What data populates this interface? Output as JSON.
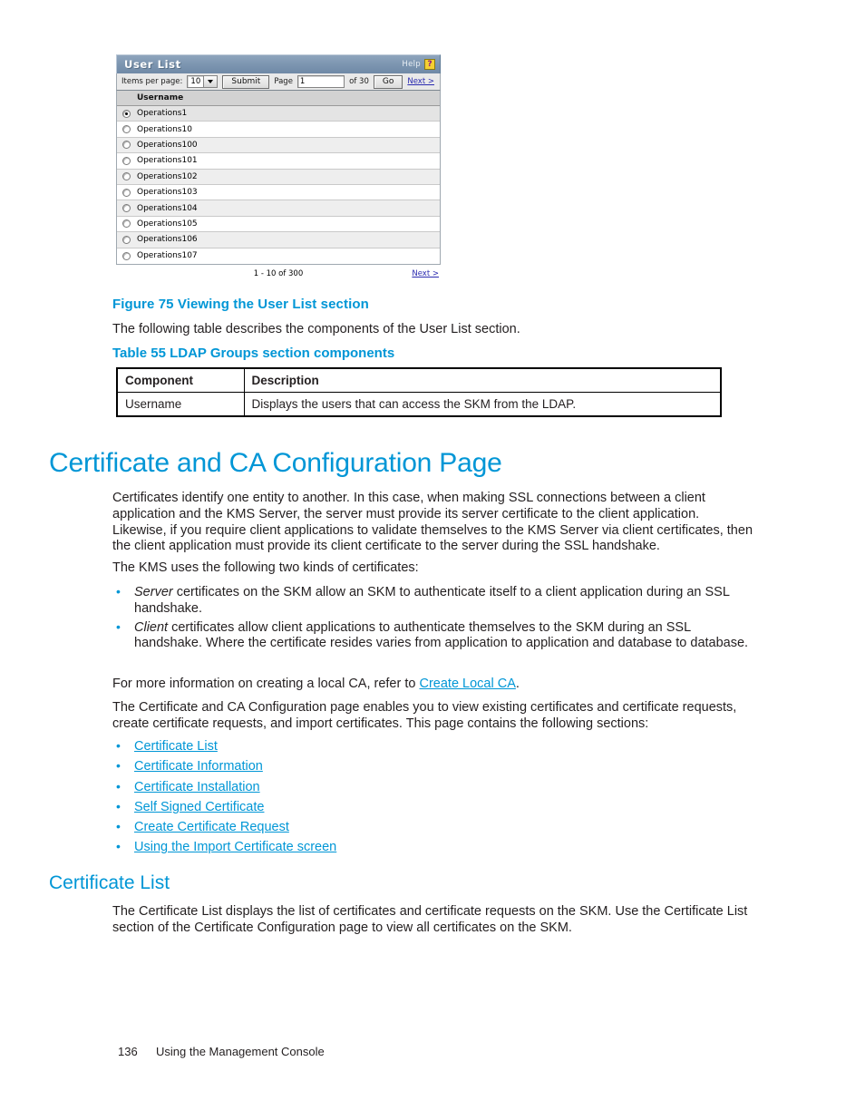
{
  "screenshot": {
    "title": "User List",
    "help_label": "Help",
    "help_icon": "question-mark-icon",
    "toolbar": {
      "items_per_page_label": "Items per page:",
      "items_per_page_value": "10",
      "submit_label": "Submit",
      "page_label": "Page",
      "page_value": "1",
      "of_label": "of 30",
      "go_label": "Go",
      "next_label": "Next >"
    },
    "column_header": "Username",
    "rows": [
      {
        "username": "Operations1",
        "selected": true
      },
      {
        "username": "Operations10",
        "selected": false
      },
      {
        "username": "Operations100",
        "selected": false
      },
      {
        "username": "Operations101",
        "selected": false
      },
      {
        "username": "Operations102",
        "selected": false
      },
      {
        "username": "Operations103",
        "selected": false
      },
      {
        "username": "Operations104",
        "selected": false
      },
      {
        "username": "Operations105",
        "selected": false
      },
      {
        "username": "Operations106",
        "selected": false
      },
      {
        "username": "Operations107",
        "selected": false
      }
    ],
    "footer": {
      "range": "1 - 10 of 300",
      "next_label": "Next >"
    }
  },
  "document": {
    "figure_caption": "Figure 75 Viewing the User List section",
    "intro_paragraph": "The following table describes the components of the User List section.",
    "table_caption": "Table 55 LDAP Groups section components",
    "table": {
      "headers": [
        "Component",
        "Description"
      ],
      "rows": [
        [
          "Username",
          "Displays the users that can access the SKM from the LDAP."
        ]
      ]
    },
    "page_title": "Certificate and CA Configuration Page",
    "p1": "Certificates identify one entity to another.  In this case, when making SSL connections between a client application and the KMS Server, the server must provide its server certificate to the client application.  Likewise, if you require client applications to validate themselves to the KMS Server via client certificates, then the client application must provide its client certificate to the server during the SSL handshake.",
    "p2": "The KMS uses the following two kinds of certificates:",
    "cert_kinds": [
      {
        "emphasis": "Server",
        "text": " certificates on the SKM allow an SKM to authenticate itself to a client application during an SSL handshake."
      },
      {
        "emphasis": "Client",
        "text": " certificates allow client applications to authenticate themselves to the SKM during an SSL handshake.  Where the certificate resides varies from application to application and database to database."
      }
    ],
    "p3_before_link": "For more information on creating a local CA, refer to ",
    "p3_link": "Create Local CA",
    "p3_after_link": ".",
    "p4": "The Certificate and CA Configuration page enables you to view existing certificates and certificate requests, create certificate requests, and import certificates.  This page contains the following sections:",
    "sections": [
      "Certificate List",
      "Certificate Information",
      "Certificate Installation",
      "Self Signed Certificate",
      "Create Certificate Request",
      "Using the Import Certificate screen"
    ],
    "section_title": "Certificate List",
    "p5": "The Certificate List displays the list of certificates and certificate requests on the SKM. Use the Certificate List section of the Certificate Configuration page to view all certificates on the SKM.",
    "footer": {
      "page_number": "136",
      "chapter": "Using the Management Console"
    }
  },
  "colors": {
    "heading_blue": "#0096D6",
    "link_blue": "#0096D6",
    "titlebar": "#7e97b2",
    "body_text": "#231F20"
  }
}
